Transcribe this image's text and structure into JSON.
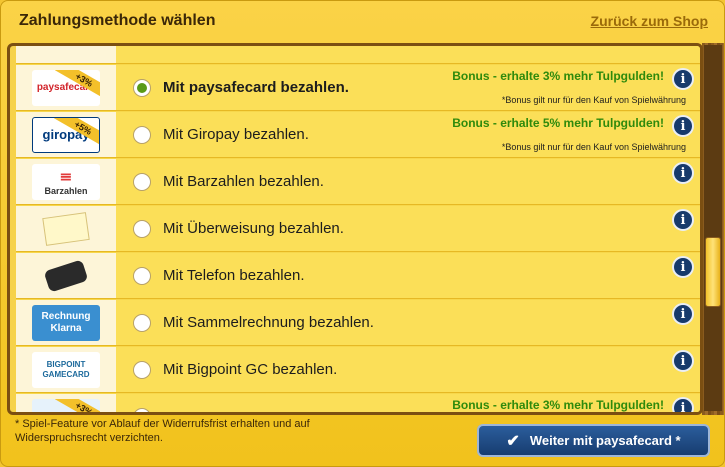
{
  "header": {
    "title": "Zahlungsmethode wählen",
    "back_label": "Zurück zum Shop"
  },
  "methods": [
    {
      "id": "paysafecard",
      "label": "Mit paysafecard bezahlen.",
      "logo_text": "paysafecard",
      "badge": "+3%",
      "selected": true,
      "bonus": "Bonus - erhalte 3% mehr Tulpgulden!",
      "note": "*Bonus gilt nur für den Kauf von Spielwährung"
    },
    {
      "id": "giropay",
      "label": "Mit Giropay bezahlen.",
      "logo_text": "giropay",
      "badge": "+5%",
      "selected": false,
      "bonus": "Bonus - erhalte 5% mehr Tulpgulden!",
      "note": "*Bonus gilt nur für den Kauf von Spielwährung"
    },
    {
      "id": "barzahlen",
      "label": "Mit Barzahlen bezahlen.",
      "logo_text": "Barzahlen",
      "selected": false
    },
    {
      "id": "ueberweisung",
      "label": "Mit Überweisung bezahlen.",
      "selected": false
    },
    {
      "id": "telefon",
      "label": "Mit Telefon bezahlen.",
      "selected": false
    },
    {
      "id": "sammelrechnung",
      "label": "Mit Sammelrechnung bezahlen.",
      "logo_text": "Rechnung Klarna",
      "selected": false
    },
    {
      "id": "bigpoint",
      "label": "Mit Bigpoint GC bezahlen.",
      "logo_text": "BIGPOINT GAMECARD",
      "selected": false
    },
    {
      "id": "partial",
      "label": "",
      "badge": "+3%",
      "selected": false,
      "bonus": "Bonus - erhalte 3% mehr Tulpgulden!"
    }
  ],
  "info_symbol": "i",
  "footer": {
    "note": "* Spiel-Feature vor Ablauf der Widerrufsfrist erhalten und auf Widerspruchsrecht verzichten.",
    "continue_label": "Weiter mit paysafecard *"
  },
  "colors": {
    "accent": "#f6d24a",
    "bonus": "#2f8a0c",
    "button": "#1f4c86",
    "selected_radio": "#5a9a17"
  }
}
